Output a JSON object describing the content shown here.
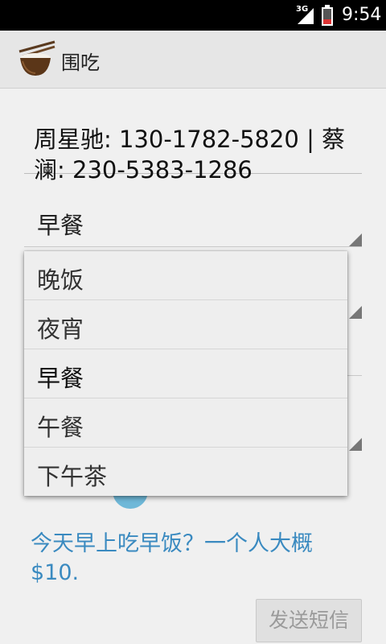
{
  "status_bar": {
    "network": "3G",
    "time": "9:54"
  },
  "action_bar": {
    "icon": "rice-bowl-chopsticks-icon",
    "title": "围吃"
  },
  "contacts": {
    "value": "周星驰: 130-1782-5820 | 蔡澜: 230-5383-1286"
  },
  "meal_spinner": {
    "selected": "早餐"
  },
  "dropdown": {
    "options": [
      "晚饭",
      "夜宵",
      "早餐",
      "午餐",
      "下午茶"
    ],
    "selected_index": 2
  },
  "message": {
    "text": "今天早上吃早饭？一个人大概$10."
  },
  "send_button": {
    "label": "发送短信"
  },
  "colors": {
    "status_bar": "#000000",
    "action_bar": "#e6e6e6",
    "link_text": "#3a8ac0",
    "background": "#f0f0f0"
  }
}
